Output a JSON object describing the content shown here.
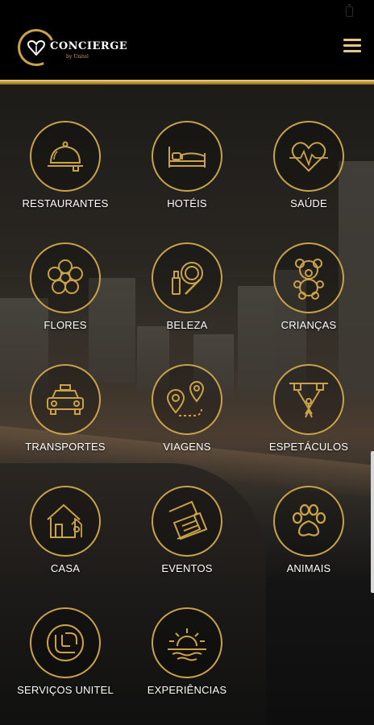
{
  "app": {
    "name": "CONCIERGE",
    "subtitle": "by Unitel"
  },
  "colors": {
    "accent": "#c9a24a",
    "header_bg": "#000000",
    "label": "#ffffff"
  },
  "header": {
    "menu_icon": "hamburger-menu-icon"
  },
  "services": [
    {
      "label": "RESTAURANTES",
      "icon": "cloche-icon"
    },
    {
      "label": "HOTÉIS",
      "icon": "bed-icon"
    },
    {
      "label": "SAÚDE",
      "icon": "heartbeat-icon"
    },
    {
      "label": "FLORES",
      "icon": "flower-icon"
    },
    {
      "label": "BELEZA",
      "icon": "makeup-icon"
    },
    {
      "label": "CRIANÇAS",
      "icon": "teddy-bear-icon"
    },
    {
      "label": "TRANSPORTES",
      "icon": "taxi-icon"
    },
    {
      "label": "VIAGENS",
      "icon": "route-pins-icon"
    },
    {
      "label": "ESPETÁCULOS",
      "icon": "stage-lights-icon"
    },
    {
      "label": "CASA",
      "icon": "house-icon"
    },
    {
      "label": "EVENTOS",
      "icon": "tickets-icon"
    },
    {
      "label": "ANIMAIS",
      "icon": "paw-icon"
    },
    {
      "label": "SERVIÇOS UNITEL",
      "icon": "unitel-logo-icon"
    },
    {
      "label": "EXPERIÊNCIAS",
      "icon": "sunset-icon"
    }
  ]
}
